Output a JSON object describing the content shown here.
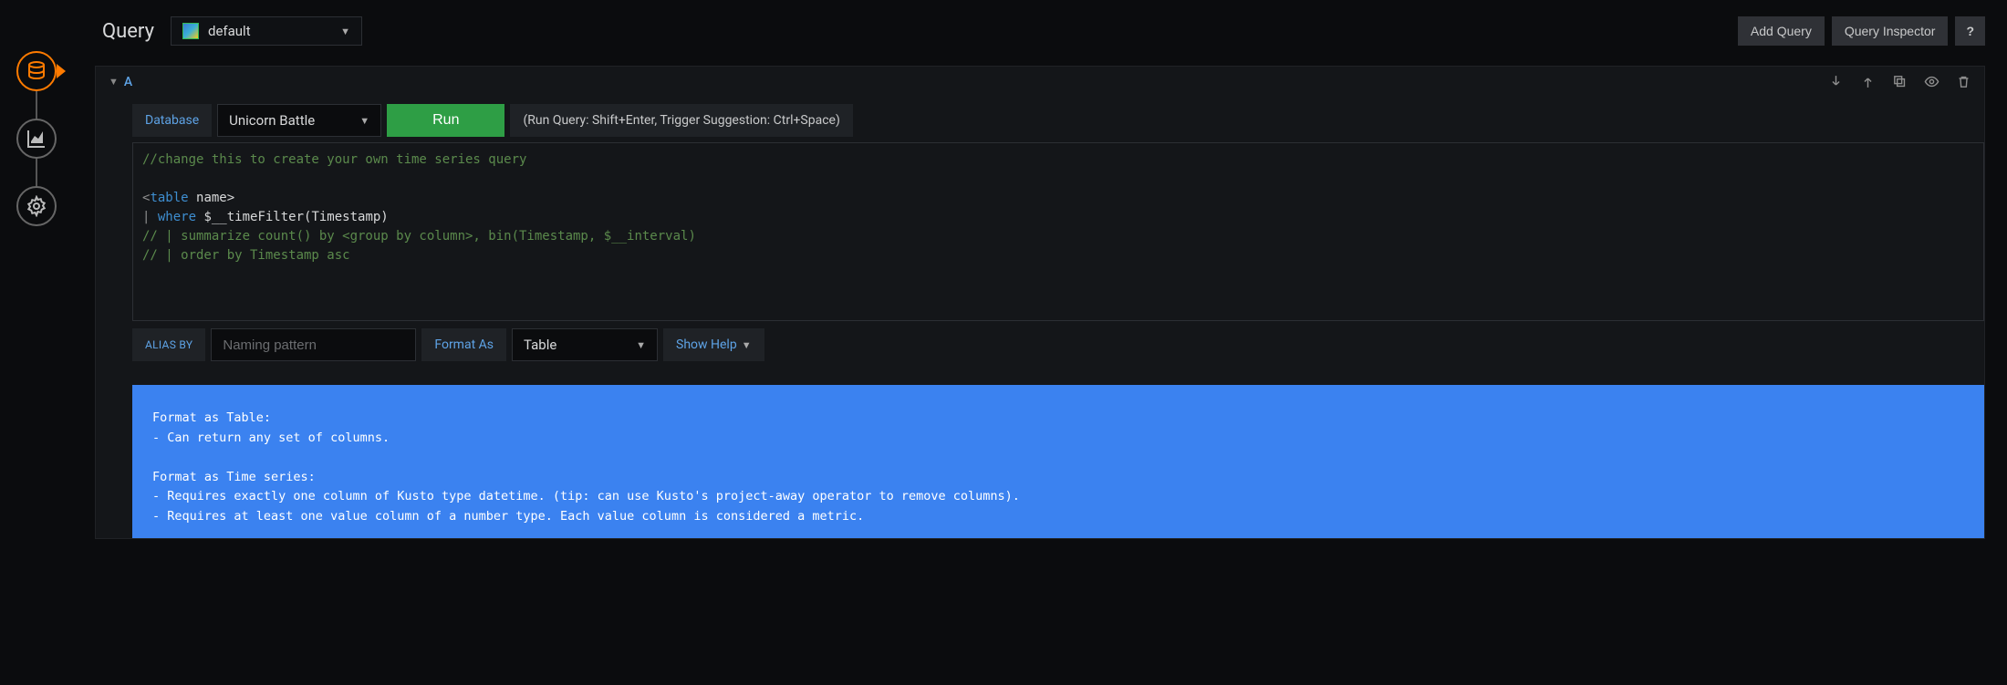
{
  "page": {
    "title": "Query"
  },
  "datasource": {
    "selected": "default"
  },
  "toolbar": {
    "add_query": "Add Query",
    "inspector": "Query Inspector",
    "help": "?"
  },
  "stepper": {
    "items": [
      "datasource",
      "visualization",
      "settings"
    ],
    "active_index": 0
  },
  "query": {
    "ref_id": "A",
    "database_label": "Database",
    "database_selected": "Unicorn Battle",
    "run_label": "Run",
    "run_hint": "(Run Query: Shift+Enter, Trigger Suggestion: Ctrl+Space)",
    "code": {
      "l1": "//change this to create your own time series query",
      "l2": "",
      "l3_open": "<",
      "l3_tag": "table",
      "l3_rest": " name>",
      "l4_pipe": "| ",
      "l4_kw": "where",
      "l4_rest": " $__timeFilter(Timestamp)",
      "l5": "// | summarize count() by <group by column>, bin(Timestamp, $__interval)",
      "l6": "// | order by Timestamp asc"
    },
    "alias_by_label": "ALIAS BY",
    "alias_by_placeholder": "Naming pattern",
    "format_as_label": "Format As",
    "format_as_selected": "Table",
    "show_help_label": "Show Help"
  },
  "help_text": "Format as Table:\n- Can return any set of columns.\n\nFormat as Time series:\n- Requires exactly one column of Kusto type datetime. (tip: can use Kusto's project-away operator to remove columns).\n- Requires at least one value column of a number type. Each value column is considered a metric."
}
